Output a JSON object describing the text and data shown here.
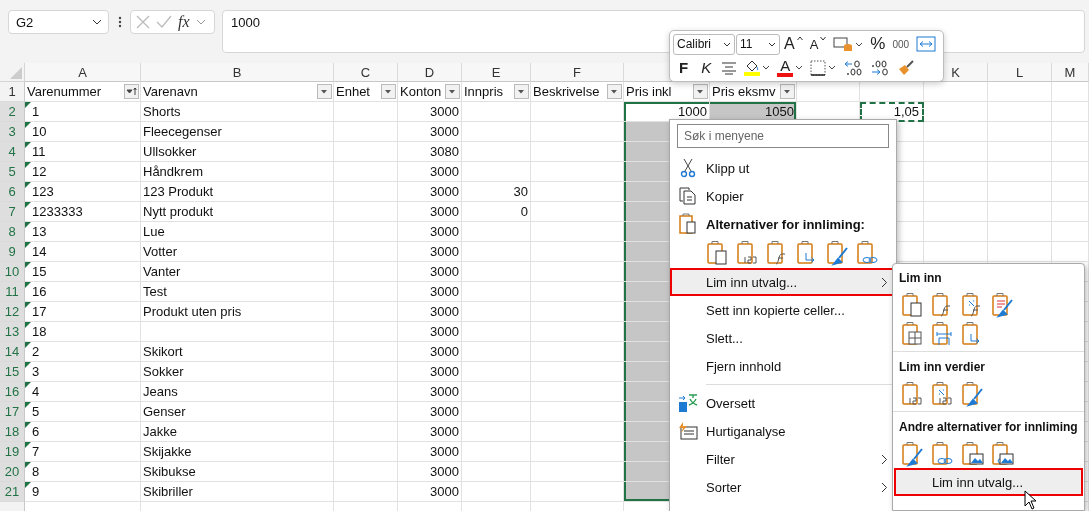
{
  "formula_bar": {
    "name_box": "G2",
    "fx": "fx",
    "value": "1000"
  },
  "columns": [
    "A",
    "B",
    "C",
    "D",
    "E",
    "F",
    null,
    null,
    null,
    null,
    "K",
    "L",
    "M"
  ],
  "header_row": {
    "row": "1",
    "cells": [
      {
        "text": "Varenummer",
        "sorted": true
      },
      {
        "text": "Varenavn",
        "sorted": false
      },
      {
        "text": "Enhet",
        "sorted": false
      },
      {
        "text": "Konton",
        "sorted": false
      },
      {
        "text": "Innpris",
        "sorted": false
      },
      {
        "text": "Beskrivelse",
        "sorted": false
      },
      {
        "text": "Pris inkl",
        "sorted": false
      },
      {
        "text": "Pris eksmv",
        "sorted": false
      }
    ]
  },
  "rows": [
    {
      "row": "2",
      "selected": true,
      "active": true,
      "a": "1",
      "b": "Shorts",
      "d": "3000",
      "g": "1000",
      "h": "1050",
      "j": {
        "text": "1,05",
        "copied": true
      }
    },
    {
      "row": "3",
      "selected": true,
      "active": false,
      "a": "10",
      "b": "Fleecegenser",
      "d": "3000"
    },
    {
      "row": "4",
      "selected": true,
      "active": false,
      "a": "11",
      "b": "Ullsokker",
      "d": "3080"
    },
    {
      "row": "5",
      "selected": true,
      "active": false,
      "a": "12",
      "b": "Håndkrem",
      "d": "3000"
    },
    {
      "row": "6",
      "selected": true,
      "active": false,
      "a": "123",
      "b": "123 Produkt",
      "d": "3000",
      "e": "30"
    },
    {
      "row": "7",
      "selected": true,
      "active": false,
      "a": "1233333",
      "b": "Nytt produkt",
      "d": "3000",
      "e": "0"
    },
    {
      "row": "8",
      "selected": true,
      "active": false,
      "a": "13",
      "b": "Lue",
      "d": "3000"
    },
    {
      "row": "9",
      "selected": true,
      "active": false,
      "a": "14",
      "b": "Votter",
      "d": "3000"
    },
    {
      "row": "10",
      "selected": true,
      "active": false,
      "a": "15",
      "b": "Vanter",
      "d": "3000"
    },
    {
      "row": "11",
      "selected": true,
      "active": false,
      "a": "16",
      "b": "Test",
      "d": "3000"
    },
    {
      "row": "12",
      "selected": true,
      "active": false,
      "a": "17",
      "b": "Produkt uten pris",
      "d": "3000"
    },
    {
      "row": "13",
      "selected": true,
      "active": false,
      "a": "18",
      "d": "3000"
    },
    {
      "row": "14",
      "selected": true,
      "active": false,
      "a": "2",
      "b": "Skikort",
      "d": "3000"
    },
    {
      "row": "15",
      "selected": true,
      "active": false,
      "a": "3",
      "b": "Sokker",
      "d": "3000"
    },
    {
      "row": "16",
      "selected": true,
      "active": false,
      "a": "4",
      "b": "Jeans",
      "d": "3000"
    },
    {
      "row": "17",
      "selected": true,
      "active": false,
      "a": "5",
      "b": "Genser",
      "d": "3000"
    },
    {
      "row": "18",
      "selected": true,
      "active": false,
      "a": "6",
      "b": "Jakke",
      "d": "3000"
    },
    {
      "row": "19",
      "selected": true,
      "active": false,
      "a": "7",
      "b": "Skijakke",
      "d": "3000"
    },
    {
      "row": "20",
      "selected": true,
      "active": false,
      "a": "8",
      "b": "Skibukse",
      "d": "3000"
    },
    {
      "row": "21",
      "selected": true,
      "active": false,
      "a": "9",
      "b": "Skibriller",
      "d": "3000"
    }
  ],
  "mini_toolbar": {
    "font": "Calibri",
    "size": "11",
    "row1": [
      {
        "kind": "grow",
        "label": "A",
        "dropdown": false
      },
      {
        "kind": "shrink",
        "label": "A",
        "dropdown": false
      },
      {
        "kind": "cellstyle",
        "dropdown": true
      },
      {
        "kind": "percent",
        "label": "%",
        "dropdown": false
      },
      {
        "kind": "thousands",
        "label": "000",
        "dropdown": false
      },
      {
        "kind": "merge",
        "dropdown": false
      }
    ],
    "row2": [
      {
        "kind": "bold",
        "label": "F",
        "dropdown": false
      },
      {
        "kind": "italic",
        "label": "K",
        "dropdown": false
      },
      {
        "kind": "align",
        "dropdown": false
      },
      {
        "kind": "fill",
        "color": "#ffff00",
        "dropdown": true
      },
      {
        "kind": "fontcolor",
        "label": "A",
        "color": "#ee1111",
        "dropdown": true
      },
      {
        "kind": "borders",
        "dropdown": true
      },
      {
        "kind": "decinc",
        "dropdown": false
      },
      {
        "kind": "decdec",
        "dropdown": false
      },
      {
        "kind": "painter",
        "dropdown": false
      }
    ]
  },
  "context_menu": {
    "search_placeholder": "Søk i menyene",
    "items": [
      {
        "kind": "cut",
        "label": "Klipp ut",
        "submenu": false,
        "highlighted": false
      },
      {
        "kind": "copy",
        "label": "Kopier",
        "submenu": false,
        "highlighted": false
      },
      {
        "kind": "heading",
        "label": "Alternativer for innliming:"
      },
      {
        "kind": "iconrow"
      },
      {
        "kind": "plain",
        "label": "Lim inn utvalg...",
        "submenu": true,
        "highlighted": true
      },
      {
        "kind": "plain",
        "label": "Sett inn kopierte celler...",
        "submenu": false,
        "highlighted": false
      },
      {
        "kind": "plain",
        "label": "Slett...",
        "submenu": false,
        "highlighted": false
      },
      {
        "kind": "plain",
        "label": "Fjern innhold",
        "submenu": false,
        "highlighted": false
      },
      {
        "kind": "separator"
      },
      {
        "kind": "translate",
        "label": "Oversett",
        "submenu": false,
        "highlighted": false
      },
      {
        "kind": "analysis",
        "label": "Hurtiganalyse",
        "submenu": false,
        "highlighted": false
      },
      {
        "kind": "plain",
        "label": "Filter",
        "submenu": true,
        "highlighted": false
      },
      {
        "kind": "plain",
        "label": "Sorter",
        "submenu": true,
        "highlighted": false
      }
    ]
  },
  "submenu": {
    "items": [
      {
        "kind": "heading",
        "label": "Lim inn"
      },
      {
        "kind": "iconrow"
      },
      {
        "kind": "iconrow"
      },
      {
        "kind": "separator"
      },
      {
        "kind": "heading",
        "label": "Lim inn verdier"
      },
      {
        "kind": "iconrow"
      },
      {
        "kind": "separator"
      },
      {
        "kind": "heading",
        "label": "Andre alternativer for innliming"
      },
      {
        "kind": "iconrow"
      },
      {
        "kind": "plain",
        "label": "Lim inn utvalg...",
        "highlighted": true
      }
    ]
  }
}
